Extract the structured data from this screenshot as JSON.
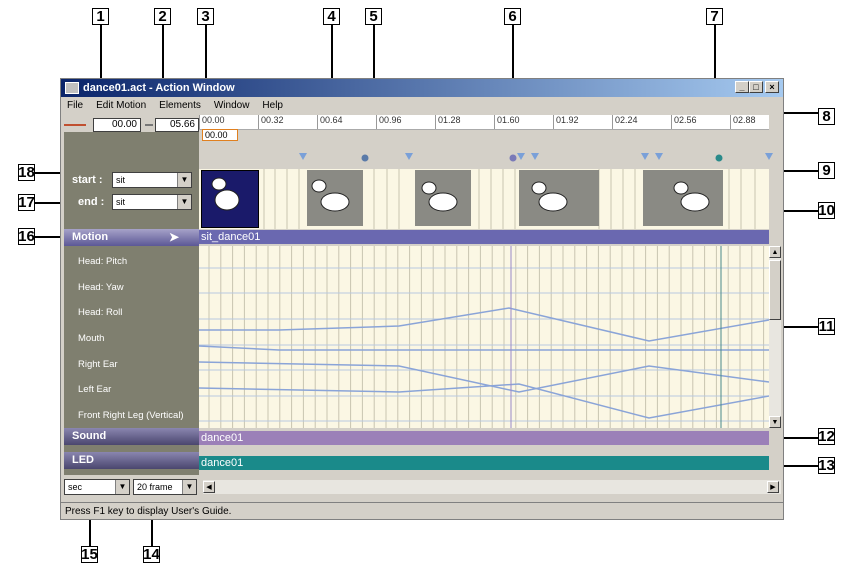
{
  "window": {
    "title": "dance01.act - Action Window",
    "min": "_",
    "max": "□",
    "close": "×"
  },
  "menu": [
    "File",
    "Edit Motion",
    "Elements",
    "Window",
    "Help"
  ],
  "toolbar": {
    "start_time": "00.00",
    "end_time": "05.66",
    "cursor_time": "00.00"
  },
  "ruler": [
    "00.00",
    "00.32",
    "00.64",
    "00.96",
    "01.28",
    "01.60",
    "01.92",
    "02.24",
    "02.56",
    "02.88"
  ],
  "left": {
    "start_label": "start :",
    "start_value": "sit",
    "end_label": "end :",
    "end_value": "sit",
    "motion_label": "Motion",
    "motion_arrow": "➤",
    "rows": [
      "Head: Pitch",
      "Head: Yaw",
      "Head: Roll",
      "Mouth",
      "Right Ear",
      "Left Ear",
      "Front Right Leg (Vertical)"
    ],
    "sound_label": "Sound",
    "led_label": "LED"
  },
  "tracks": {
    "motion": "sit_dance01",
    "sound": "dance01",
    "led": "dance01"
  },
  "bottom": {
    "unit": "sec",
    "frame": "20 frame"
  },
  "status": "Press F1 key to display User's Guide.",
  "callouts": [
    "1",
    "2",
    "3",
    "4",
    "5",
    "6",
    "7",
    "8",
    "9",
    "10",
    "11",
    "12",
    "13",
    "14",
    "15",
    "16",
    "17",
    "18"
  ],
  "colors": {
    "motion": "#6a68b0",
    "sound": "#9b80b8",
    "led": "#1a8a8a",
    "curve": "#8aa4d8",
    "marker_line": "#4a8a8a"
  }
}
